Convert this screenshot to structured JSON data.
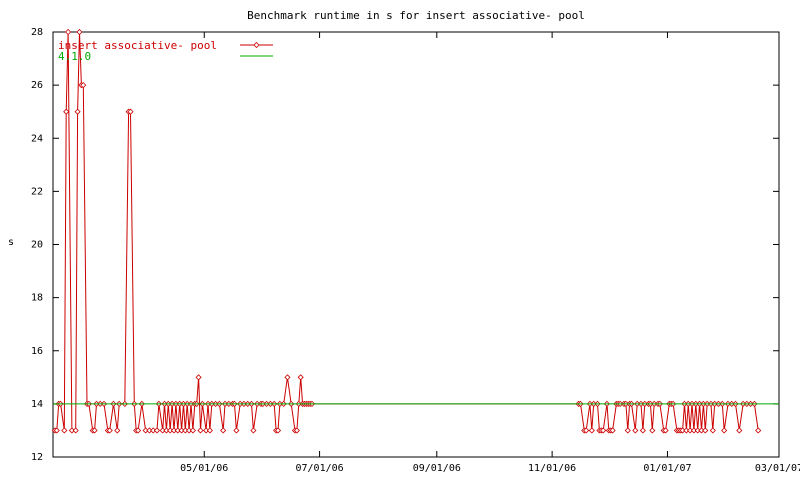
{
  "chart_data": {
    "type": "line",
    "title": "Benchmark runtime in s for insert associative-  pool",
    "xlabel": "",
    "ylabel": "s",
    "ylim": [
      12,
      28
    ],
    "xlim": [
      "2006-02-10",
      "2007-03-01"
    ],
    "x_ticks": [
      "05/01/06",
      "07/01/06",
      "09/01/06",
      "11/01/06",
      "01/01/07",
      "03/01/07"
    ],
    "x_tick_dates": [
      "2006-05-01",
      "2006-07-01",
      "2006-09-01",
      "2006-11-01",
      "2007-01-01",
      "2007-03-01"
    ],
    "y_ticks": [
      12,
      14,
      16,
      18,
      20,
      22,
      24,
      26,
      28
    ],
    "grid": false,
    "legend": "top-left",
    "series": [
      {
        "name": "insert associative-  pool",
        "color": "#cc0000",
        "marker": "diamond",
        "points": [
          [
            "2006-02-11",
            13
          ],
          [
            "2006-02-12",
            13
          ],
          [
            "2006-02-13",
            14
          ],
          [
            "2006-02-14",
            14
          ],
          [
            "2006-02-16",
            13
          ],
          [
            "2006-02-17",
            25
          ],
          [
            "2006-02-18",
            28
          ],
          [
            "2006-02-20",
            13
          ],
          [
            "2006-02-22",
            13
          ],
          [
            "2006-02-23",
            25
          ],
          [
            "2006-02-24",
            28
          ],
          [
            "2006-02-25",
            26
          ],
          [
            "2006-02-26",
            26
          ],
          [
            "2006-02-28",
            14
          ],
          [
            "2006-03-01",
            14
          ],
          [
            "2006-03-03",
            13
          ],
          [
            "2006-03-04",
            13
          ],
          [
            "2006-03-05",
            14
          ],
          [
            "2006-03-07",
            14
          ],
          [
            "2006-03-09",
            14
          ],
          [
            "2006-03-11",
            13
          ],
          [
            "2006-03-12",
            13
          ],
          [
            "2006-03-14",
            14
          ],
          [
            "2006-03-16",
            13
          ],
          [
            "2006-03-17",
            14
          ],
          [
            "2006-03-20",
            14
          ],
          [
            "2006-03-22",
            25
          ],
          [
            "2006-03-23",
            25
          ],
          [
            "2006-03-25",
            14
          ],
          [
            "2006-03-26",
            13
          ],
          [
            "2006-03-27",
            13
          ],
          [
            "2006-03-29",
            14
          ],
          [
            "2006-03-31",
            13
          ],
          [
            "2006-04-02",
            13
          ],
          [
            "2006-04-04",
            13
          ],
          [
            "2006-04-06",
            13
          ],
          [
            "2006-04-07",
            14
          ],
          [
            "2006-04-09",
            13
          ],
          [
            "2006-04-10",
            14
          ],
          [
            "2006-04-11",
            13
          ],
          [
            "2006-04-12",
            14
          ],
          [
            "2006-04-13",
            13
          ],
          [
            "2006-04-14",
            14
          ],
          [
            "2006-04-15",
            13
          ],
          [
            "2006-04-16",
            14
          ],
          [
            "2006-04-17",
            13
          ],
          [
            "2006-04-18",
            14
          ],
          [
            "2006-04-19",
            13
          ],
          [
            "2006-04-20",
            14
          ],
          [
            "2006-04-21",
            13
          ],
          [
            "2006-04-22",
            14
          ],
          [
            "2006-04-23",
            13
          ],
          [
            "2006-04-24",
            14
          ],
          [
            "2006-04-25",
            13
          ],
          [
            "2006-04-26",
            14
          ],
          [
            "2006-04-27",
            14
          ],
          [
            "2006-04-28",
            15
          ],
          [
            "2006-04-29",
            13
          ],
          [
            "2006-04-30",
            14
          ],
          [
            "2006-05-02",
            13
          ],
          [
            "2006-05-03",
            14
          ],
          [
            "2006-05-04",
            13
          ],
          [
            "2006-05-05",
            14
          ],
          [
            "2006-05-07",
            14
          ],
          [
            "2006-05-09",
            14
          ],
          [
            "2006-05-11",
            13
          ],
          [
            "2006-05-12",
            14
          ],
          [
            "2006-05-14",
            14
          ],
          [
            "2006-05-16",
            14
          ],
          [
            "2006-05-17",
            14
          ],
          [
            "2006-05-18",
            13
          ],
          [
            "2006-05-20",
            14
          ],
          [
            "2006-05-22",
            14
          ],
          [
            "2006-05-24",
            14
          ],
          [
            "2006-05-26",
            14
          ],
          [
            "2006-05-27",
            13
          ],
          [
            "2006-05-29",
            14
          ],
          [
            "2006-05-31",
            14
          ],
          [
            "2006-06-01",
            14
          ],
          [
            "2006-06-03",
            14
          ],
          [
            "2006-06-05",
            14
          ],
          [
            "2006-06-07",
            14
          ],
          [
            "2006-06-08",
            13
          ],
          [
            "2006-06-09",
            13
          ],
          [
            "2006-06-10",
            14
          ],
          [
            "2006-06-12",
            14
          ],
          [
            "2006-06-14",
            15
          ],
          [
            "2006-06-16",
            14
          ],
          [
            "2006-06-18",
            13
          ],
          [
            "2006-06-19",
            13
          ],
          [
            "2006-06-20",
            14
          ],
          [
            "2006-06-21",
            15
          ],
          [
            "2006-06-22",
            14
          ],
          [
            "2006-06-23",
            14
          ],
          [
            "2006-06-24",
            14
          ],
          [
            "2006-06-25",
            14
          ],
          [
            "2006-06-26",
            14
          ],
          [
            "2006-06-27",
            14
          ],
          [
            "2006-11-15",
            14
          ],
          [
            "2006-11-16",
            14
          ],
          [
            "2006-11-18",
            13
          ],
          [
            "2006-11-19",
            13
          ],
          [
            "2006-11-21",
            14
          ],
          [
            "2006-11-22",
            13
          ],
          [
            "2006-11-23",
            14
          ],
          [
            "2006-11-25",
            14
          ],
          [
            "2006-11-26",
            13
          ],
          [
            "2006-11-27",
            13
          ],
          [
            "2006-11-28",
            13
          ],
          [
            "2006-11-30",
            14
          ],
          [
            "2006-12-01",
            13
          ],
          [
            "2006-12-02",
            13
          ],
          [
            "2006-12-03",
            13
          ],
          [
            "2006-12-05",
            14
          ],
          [
            "2006-12-06",
            14
          ],
          [
            "2006-12-07",
            14
          ],
          [
            "2006-12-09",
            14
          ],
          [
            "2006-12-10",
            14
          ],
          [
            "2006-12-11",
            13
          ],
          [
            "2006-12-12",
            14
          ],
          [
            "2006-12-13",
            14
          ],
          [
            "2006-12-15",
            13
          ],
          [
            "2006-12-16",
            14
          ],
          [
            "2006-12-18",
            14
          ],
          [
            "2006-12-19",
            13
          ],
          [
            "2006-12-20",
            14
          ],
          [
            "2006-12-22",
            14
          ],
          [
            "2006-12-23",
            14
          ],
          [
            "2006-12-24",
            13
          ],
          [
            "2006-12-25",
            14
          ],
          [
            "2006-12-27",
            14
          ],
          [
            "2006-12-28",
            14
          ],
          [
            "2006-12-30",
            13
          ],
          [
            "2006-12-31",
            13
          ],
          [
            "2007-01-02",
            14
          ],
          [
            "2007-01-03",
            14
          ],
          [
            "2007-01-04",
            14
          ],
          [
            "2007-01-06",
            13
          ],
          [
            "2007-01-07",
            13
          ],
          [
            "2007-01-08",
            13
          ],
          [
            "2007-01-09",
            13
          ],
          [
            "2007-01-10",
            14
          ],
          [
            "2007-01-11",
            13
          ],
          [
            "2007-01-12",
            14
          ],
          [
            "2007-01-13",
            13
          ],
          [
            "2007-01-14",
            14
          ],
          [
            "2007-01-15",
            13
          ],
          [
            "2007-01-16",
            14
          ],
          [
            "2007-01-17",
            13
          ],
          [
            "2007-01-18",
            14
          ],
          [
            "2007-01-19",
            13
          ],
          [
            "2007-01-20",
            14
          ],
          [
            "2007-01-21",
            13
          ],
          [
            "2007-01-22",
            14
          ],
          [
            "2007-01-24",
            14
          ],
          [
            "2007-01-25",
            13
          ],
          [
            "2007-01-26",
            14
          ],
          [
            "2007-01-28",
            14
          ],
          [
            "2007-01-30",
            14
          ],
          [
            "2007-01-31",
            13
          ],
          [
            "2007-02-02",
            14
          ],
          [
            "2007-02-04",
            14
          ],
          [
            "2007-02-06",
            14
          ],
          [
            "2007-02-08",
            13
          ],
          [
            "2007-02-10",
            14
          ],
          [
            "2007-02-12",
            14
          ],
          [
            "2007-02-14",
            14
          ],
          [
            "2007-02-16",
            14
          ],
          [
            "2007-02-18",
            13
          ]
        ]
      },
      {
        "name": "4.1.0",
        "color": "#00aa00",
        "marker": "none",
        "points": [
          [
            "2006-02-10",
            14
          ],
          [
            "2007-03-01",
            14
          ]
        ]
      }
    ]
  }
}
